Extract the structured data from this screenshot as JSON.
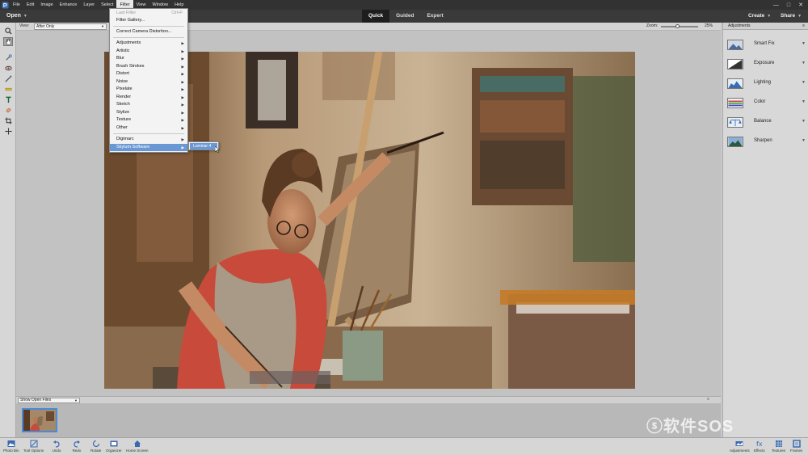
{
  "menubar": {
    "items": [
      "File",
      "Edit",
      "Image",
      "Enhance",
      "Layer",
      "Select",
      "Filter",
      "View",
      "Window",
      "Help"
    ],
    "active_item": "Filter",
    "window_controls": [
      "—",
      "□",
      "✕"
    ]
  },
  "modebar": {
    "open_label": "Open",
    "modes": [
      "Quick",
      "Guided",
      "Expert"
    ],
    "active_mode": "Quick",
    "create_label": "Create",
    "share_label": "Share"
  },
  "options": {
    "view_label": "View:",
    "view_value": "After Only",
    "zoom_label": "Zoom:",
    "zoom_value": "25%",
    "zoom_level": 0.45
  },
  "filter_menu": {
    "items": [
      {
        "label": "Last Filter",
        "shortcut": "Ctrl+F",
        "disabled": true
      },
      {
        "label": "Filter Gallery...",
        "disabled": false
      },
      {
        "label": "Correct Camera Distortion...",
        "disabled": false
      },
      {
        "label": "Adjustments",
        "submenu": true
      },
      {
        "label": "Artistic",
        "submenu": true
      },
      {
        "label": "Blur",
        "submenu": true
      },
      {
        "label": "Brush Strokes",
        "submenu": true
      },
      {
        "label": "Distort",
        "submenu": true
      },
      {
        "label": "Noise",
        "submenu": true
      },
      {
        "label": "Pixelate",
        "submenu": true
      },
      {
        "label": "Render",
        "submenu": true
      },
      {
        "label": "Sketch",
        "submenu": true
      },
      {
        "label": "Stylize",
        "submenu": true
      },
      {
        "label": "Texture",
        "submenu": true
      },
      {
        "label": "Other",
        "submenu": true
      },
      {
        "label": "Digimarc",
        "submenu": true
      },
      {
        "label": "Skylum Software",
        "submenu": true,
        "highlighted": true
      }
    ],
    "submenu_item": "Luminar 4"
  },
  "adjustments_panel": {
    "title": "Adjustments",
    "items": [
      {
        "label": "Smart Fix",
        "icon": "smart-fix-icon"
      },
      {
        "label": "Exposure",
        "icon": "exposure-icon"
      },
      {
        "label": "Lighting",
        "icon": "lighting-icon"
      },
      {
        "label": "Color",
        "icon": "color-icon"
      },
      {
        "label": "Balance",
        "icon": "balance-icon"
      },
      {
        "label": "Sharpen",
        "icon": "sharpen-icon"
      }
    ]
  },
  "photo_bin": {
    "select_value": "Show Open Files"
  },
  "taskbar": {
    "left": [
      {
        "label": "Photo Bin",
        "icon": "photo-bin-icon"
      },
      {
        "label": "Tool Options",
        "icon": "tool-options-icon"
      },
      {
        "label": "Undo",
        "icon": "undo-icon"
      },
      {
        "label": "Redo",
        "icon": "redo-icon"
      },
      {
        "label": "Rotate",
        "icon": "rotate-icon"
      },
      {
        "label": "Organizer",
        "icon": "organizer-icon"
      },
      {
        "label": "Home Screen",
        "icon": "home-icon"
      }
    ],
    "right": [
      {
        "label": "Adjustments",
        "icon": "adjustments-icon"
      },
      {
        "label": "Effects",
        "icon": "effects-icon"
      },
      {
        "label": "Textures",
        "icon": "textures-icon"
      },
      {
        "label": "Frames",
        "icon": "frames-icon"
      }
    ]
  },
  "colors": {
    "menubar_bg": "#323232",
    "highlight": "#6a98d4",
    "selection_border": "#4a8ad8"
  }
}
